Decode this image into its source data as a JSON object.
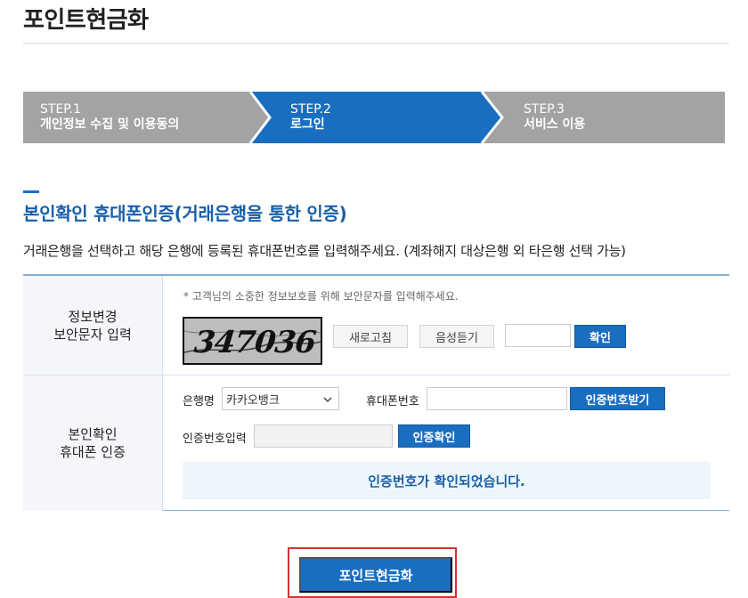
{
  "page": {
    "title": "포인트현금화"
  },
  "steps": [
    {
      "num": "STEP.1",
      "label": "개인정보 수집 및 이용동의",
      "active": false
    },
    {
      "num": "STEP.2",
      "label": "로그인",
      "active": true
    },
    {
      "num": "STEP.3",
      "label": "서비스 이용",
      "active": false
    }
  ],
  "colors": {
    "step_inactive": "#a3a3a3",
    "step_active": "#1a6ec0",
    "accent": "#1a6ec0",
    "highlight": "#d93030"
  },
  "section": {
    "title": "본인확인 휴대폰인증(거래은행을 통한 인증)",
    "description": "거래은행을 선택하고 해당 은행에 등록된 휴대폰번호를 입력해주세요. (계좌해지 대상은행 외 타은행 선택 가능)"
  },
  "security": {
    "header_line1": "정보변경",
    "header_line2": "보안문자 입력",
    "notice": "* 고객님의 소중한 정보보호를 위해 보안문자를 입력해주세요.",
    "captcha_text": "347036",
    "refresh_label": "새로고침",
    "audio_label": "음성듣기",
    "input_value": "",
    "confirm_label": "확인"
  },
  "auth": {
    "header_line1": "본인확인",
    "header_line2": "휴대폰 인증",
    "bank_label": "은행명",
    "bank_selected": "카카오뱅크",
    "phone_label": "휴대폰번호",
    "phone_value": "",
    "request_code_label": "인증번호받기",
    "code_label": "인증번호입력",
    "code_value": "",
    "verify_label": "인증확인",
    "result_message": "인증번호가 확인되었습니다."
  },
  "submit": {
    "label": "포인트현금화"
  },
  "icons": {
    "select": "chevron-down-icon"
  }
}
